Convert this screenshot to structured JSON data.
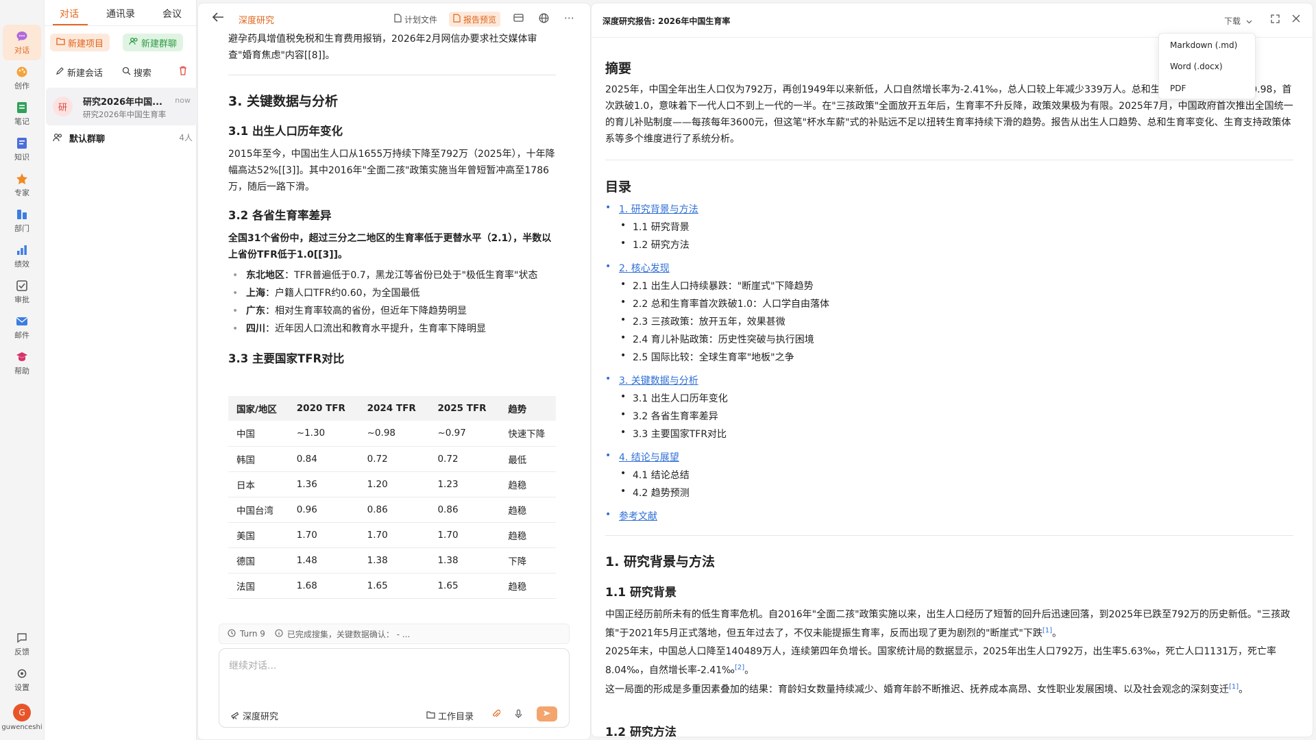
{
  "rail": {
    "items": [
      {
        "label": "对话",
        "icon": "chat-icon"
      },
      {
        "label": "创作",
        "icon": "palette-icon"
      },
      {
        "label": "笔记",
        "icon": "notebook-icon"
      },
      {
        "label": "知识",
        "icon": "book-icon"
      },
      {
        "label": "专家",
        "icon": "expert-icon"
      },
      {
        "label": "部门",
        "icon": "department-icon"
      },
      {
        "label": "绩效",
        "icon": "bar-chart-icon"
      },
      {
        "label": "审批",
        "icon": "checkbox-icon"
      },
      {
        "label": "邮件",
        "icon": "mail-icon"
      },
      {
        "label": "帮助",
        "icon": "help-icon"
      },
      {
        "label": "反馈",
        "icon": "feedback-icon"
      },
      {
        "label": "设置",
        "icon": "gear-icon"
      }
    ],
    "avatar": "G",
    "username": "guwenceshi",
    "accent": "#e26a1f"
  },
  "convlist": {
    "tabs": [
      "对话",
      "通讯录",
      "会议"
    ],
    "new_project": "新建项目",
    "new_group": "新建群聊",
    "new_chat": "新建会话",
    "search": "搜索",
    "conversation": {
      "avatar": "研",
      "title": "研究2026年中国...",
      "subtitle": "研究2026年中国生育率",
      "time": "now"
    },
    "group": {
      "name": "默认群聊",
      "count": "4人"
    }
  },
  "chat": {
    "title": "深度研究",
    "plan_file": "计划文件",
    "report_preview": "报告预览",
    "intro_text": "避孕药具增值税免税和生育费用报销，2026年2月网信办要求社交媒体审查\"婚育焦虑\"内容[[8]]。",
    "section3_title": "3. 关键数据与分析",
    "s31_title": "3.1 出生人口历年变化",
    "s31_text": "2015年至今，中国出生人口从1655万持续下降至792万（2025年），十年降幅高达52%[[3]]。其中2016年\"全面二孩\"政策实施当年曾短暂冲高至1786万，随后一路下滑。",
    "s32_title": "3.2 各省生育率差异",
    "s32_text": "全国31个省份中，超过三分之二地区的生育率低于更替水平（2.1），半数以上省份TFR低于1.0[[3]]。",
    "s32_bullets": [
      {
        "key": "东北地区",
        "text": "：TFR普遍低于0.7，黑龙江等省份已处于\"极低生育率\"状态"
      },
      {
        "key": "上海",
        "text": "：户籍人口TFR约0.60，为全国最低"
      },
      {
        "key": "广东",
        "text": "：相对生育率较高的省份，但近年下降趋势明显"
      },
      {
        "key": "四川",
        "text": "：近年因人口流出和教育水平提升，生育率下降明显"
      }
    ],
    "s33_title": "3.3 主要国家TFR对比",
    "table": {
      "headers": [
        "国家/地区",
        "2020 TFR",
        "2024 TFR",
        "2025 TFR",
        "趋势"
      ],
      "rows": [
        [
          "中国",
          "~1.30",
          "~0.98",
          "~0.97",
          "快速下降"
        ],
        [
          "韩国",
          "0.84",
          "0.72",
          "0.72",
          "最低"
        ],
        [
          "日本",
          "1.36",
          "1.20",
          "1.23",
          "趋稳"
        ],
        [
          "中国台湾",
          "0.96",
          "0.86",
          "0.86",
          "趋稳"
        ],
        [
          "美国",
          "1.70",
          "1.70",
          "1.70",
          "趋稳"
        ],
        [
          "德国",
          "1.48",
          "1.38",
          "1.38",
          "下降"
        ],
        [
          "法国",
          "1.68",
          "1.65",
          "1.65",
          "趋稳"
        ]
      ]
    },
    "status_turn": "Turn 9",
    "status_text": "已完成搜集，关键数据确认： - ...",
    "composer_placeholder": "继续对话...",
    "deep_research": "深度研究",
    "work_dir": "工作目录"
  },
  "report": {
    "title": "深度研究报告: 2026年中国生育率",
    "download": "下载",
    "download_menu": [
      "Markdown (.md)",
      "Word (.docx)",
      "PDF"
    ],
    "abstract_title": "摘要",
    "abstract_text": "2025年，中国全年出生人口仅为792万，再创1949年以来新低，人口自然增长率为-2.41‰，总人口较上年减少339万人。总和生育率（TFR）约0.97-0.98，首次跌破1.0，意味着下一代人口不到上一代的一半。在\"三孩政策\"全面放开五年后，生育率不升反降，政策效果极为有限。2025年7月，中国政府首次推出全国统一的育儿补贴制度——每孩每年3600元，但这笔\"杯水车薪\"式的补贴远不足以扭转生育率持续下滑的趋势。报告从出生人口趋势、总和生育率变化、生育支持政策体系等多个维度进行了系统分析。",
    "toc_title": "目录",
    "toc": [
      {
        "title": "1. 研究背景与方法",
        "children": [
          "1.1 研究背景",
          "1.2 研究方法"
        ]
      },
      {
        "title": "2. 核心发现",
        "children": [
          "2.1 出生人口持续暴跌：\"断崖式\"下降趋势",
          "2.2 总和生育率首次跌破1.0：人口学自由落体",
          "2.3 三孩政策：放开五年，效果甚微",
          "2.4 育儿补贴政策：历史性突破与执行困境",
          "2.5 国际比较：全球生育率\"地板\"之争"
        ]
      },
      {
        "title": "3. 关键数据与分析",
        "children": [
          "3.1 出生人口历年变化",
          "3.2 各省生育率差异",
          "3.3 主要国家TFR对比"
        ]
      },
      {
        "title": "4. 结论与展望",
        "children": [
          "4.1 结论总结",
          "4.2 趋势预测"
        ]
      },
      {
        "title": "参考文献",
        "children": []
      }
    ],
    "s1_title": "1. 研究背景与方法",
    "s11_title": "1.1 研究背景",
    "s11_p1": "中国正经历前所未有的低生育率危机。自2016年\"全面二孩\"政策实施以来，出生人口经历了短暂的回升后迅速回落，到2025年已跌至792万的历史新低。\"三孩政策\"于2021年5月正式落地，但五年过去了，不仅未能提振生育率，反而出现了更为剧烈的\"断崖式\"下跌",
    "s11_p1_cite": "[1]",
    "s11_p1_end": "。",
    "s11_p2": "2025年末，中国总人口降至140489万人，连续第四年负增长。国家统计局的数据显示，2025年出生人口792万，出生率5.63‰，死亡人口1131万，死亡率8.04‰，自然增长率-2.41‰",
    "s11_p2_cite": "[2]",
    "s11_p2_end": "。",
    "s11_p3": "这一局面的形成是多重因素叠加的结果：育龄妇女数量持续减少、婚育年龄不断推迟、抚养成本高昂、女性职业发展困境、以及社会观念的深刻变迁",
    "s11_p3_cite": "[1]",
    "s11_p3_end": "。",
    "s12_title": "1.2 研究方法"
  }
}
